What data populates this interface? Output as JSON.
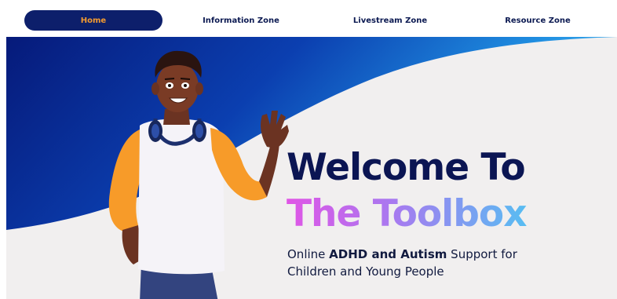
{
  "nav": {
    "items": [
      {
        "label": "Home",
        "active": true
      },
      {
        "label": "Information Zone",
        "active": false
      },
      {
        "label": "Livestream Zone",
        "active": false
      },
      {
        "label": "Resource Zone",
        "active": false
      }
    ]
  },
  "hero": {
    "headline_line1": "Welcome To",
    "headline_line2": "The Toolbox",
    "tagline_prefix": "Online",
    "tagline_strong": "ADHD and Autism",
    "tagline_line1_suffix": "Support for",
    "tagline_line2": "Children and Young People",
    "illustration": "waving-boy-illustration"
  },
  "colors": {
    "nav_active_bg": "#0d1f6b",
    "nav_active_text": "#f39a2f",
    "nav_text": "#0c1a52",
    "hero_blue": "#0a2e9e",
    "headline_dark": "#0b1553",
    "headline_gradient_start": "#e055e6",
    "headline_gradient_end": "#58bdf2",
    "hero_background": "#f1efef"
  }
}
